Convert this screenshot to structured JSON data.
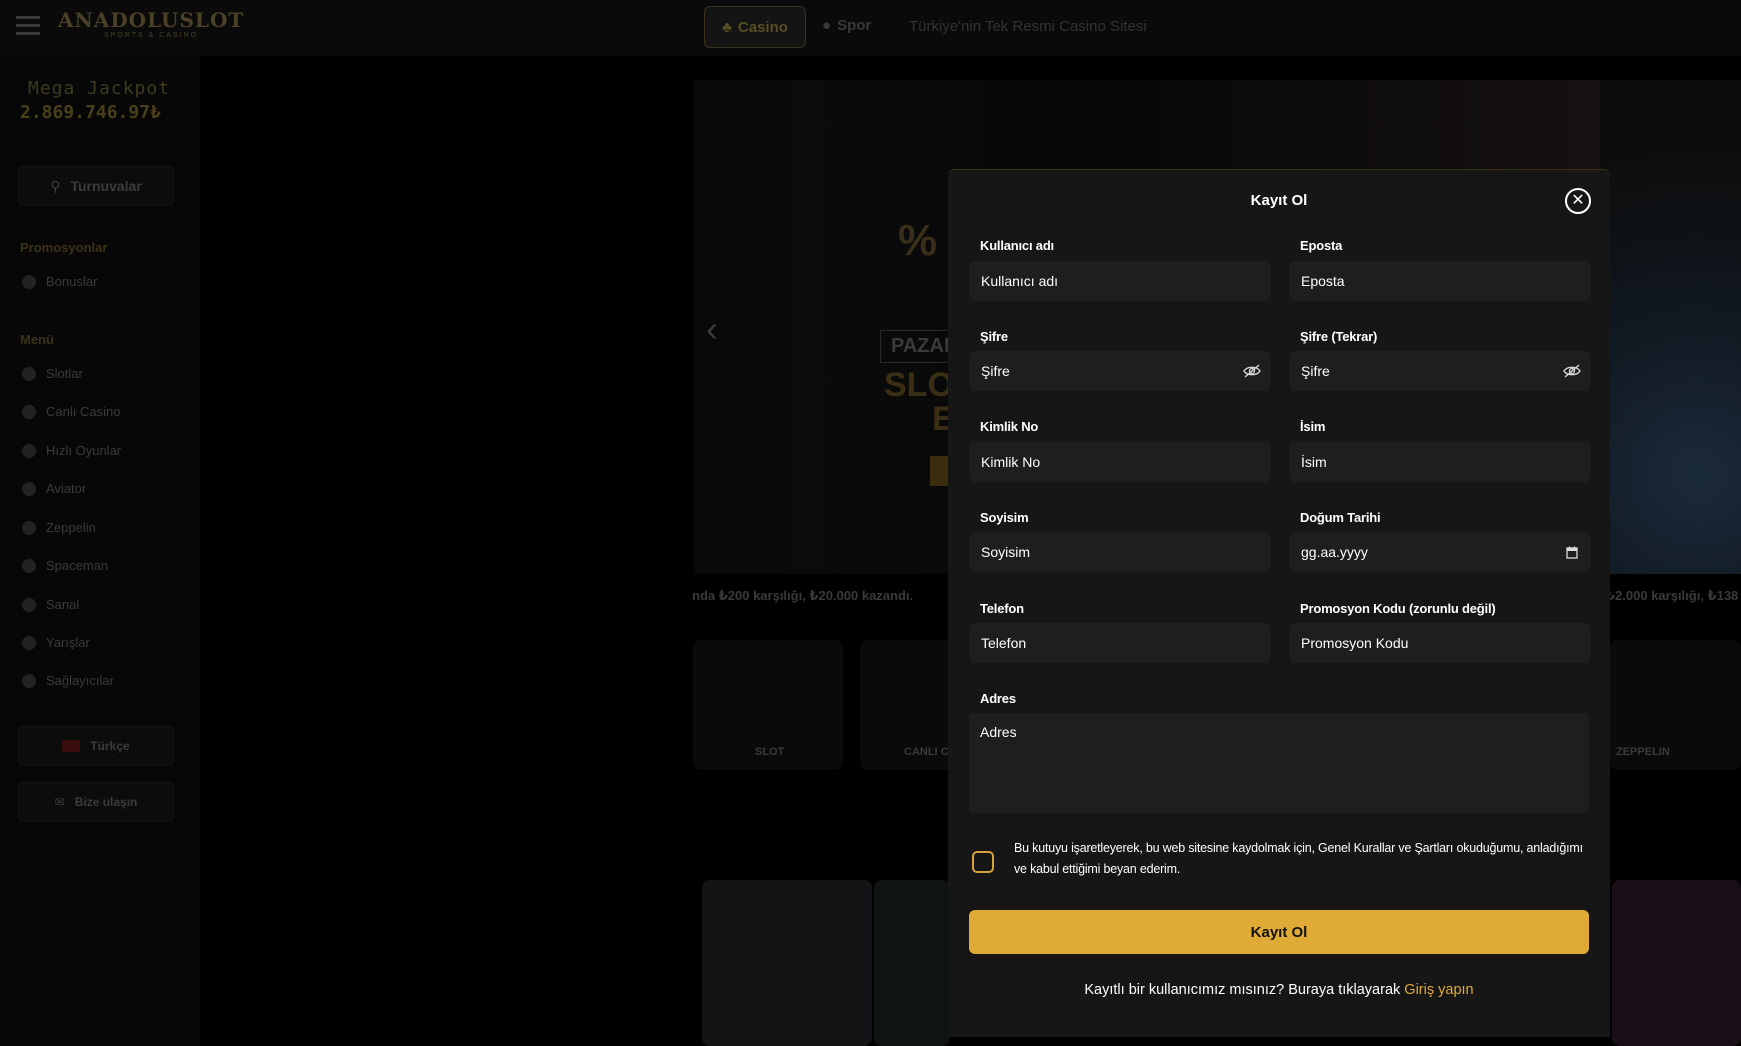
{
  "header": {
    "logo": "ANADOLUSLOT",
    "logo_sub": "SPORTS & CASINO",
    "nav_casino": "Casino",
    "nav_spor": "Spor",
    "tagline": "Türkiye'nin Tek Resmi Casino Sitesi"
  },
  "sidebar": {
    "jackpot_label": "Mega Jackpot",
    "jackpot_value": "2.869.746.97₺",
    "tournaments": "Turnuvalar",
    "promotions_heading": "Promosyonlar",
    "bonuses": "Bonuslar",
    "menu_heading": "Menü",
    "items": [
      "Slotlar",
      "Canlı Casino",
      "Hızlı Oyunlar",
      "Aviator",
      "Zeppelin",
      "Spaceman",
      "Sanal",
      "Yarışlar",
      "Sağlayıcılar"
    ],
    "language": "Türkçe",
    "contact": "Bize ulaşın"
  },
  "banner": {
    "percent": "%",
    "pazar": "PAZAR",
    "slo": "SLO",
    "e": "E"
  },
  "ticker": {
    "left": "nda ₺200 karşılığı, ₺20.000 kazandı.",
    "right": "₺2.000 karşılığı, ₺138"
  },
  "categories": {
    "slot": "SLOT",
    "canli": "CANLI CA",
    "zeppelin": "ZEPPELIN"
  },
  "modal": {
    "title": "Kayıt Ol",
    "close_icon": "close-circle-icon",
    "fields": {
      "username": {
        "label": "Kullanıcı adı",
        "placeholder": "Kullanıcı adı"
      },
      "email": {
        "label": "Eposta",
        "placeholder": "Eposta"
      },
      "password": {
        "label": "Şifre",
        "placeholder": "Şifre"
      },
      "password_repeat": {
        "label": "Şifre (Tekrar)",
        "placeholder": "Şifre"
      },
      "id_no": {
        "label": "Kimlik No",
        "placeholder": "Kimlik No"
      },
      "first_name": {
        "label": "İsim",
        "placeholder": "İsim"
      },
      "last_name": {
        "label": "Soyisim",
        "placeholder": "Soyisim"
      },
      "birth_date": {
        "label": "Doğum Tarihi",
        "placeholder": "gg.aa.yyyy"
      },
      "phone": {
        "label": "Telefon",
        "placeholder": "Telefon"
      },
      "promo": {
        "label": "Promosyon Kodu (zorunlu değil)",
        "placeholder": "Promosyon Kodu"
      },
      "address": {
        "label": "Adres",
        "placeholder": "Adres"
      }
    },
    "terms": "Bu kutuyu işaretleyerek, bu web sitesine kaydolmak için, Genel Kurallar ve Şartları okuduğumu, anladığımı ve kabul ettiğimi beyan ederim.",
    "submit": "Kayıt Ol",
    "login_prompt": "Kayıtlı bir kullanıcımız mısınız? Buraya tıklayarak",
    "login_link": "Giriş yapın"
  },
  "colors": {
    "accent": "#e0aa36",
    "modal_bg": "#161616",
    "field_bg": "#1e1e1e"
  }
}
